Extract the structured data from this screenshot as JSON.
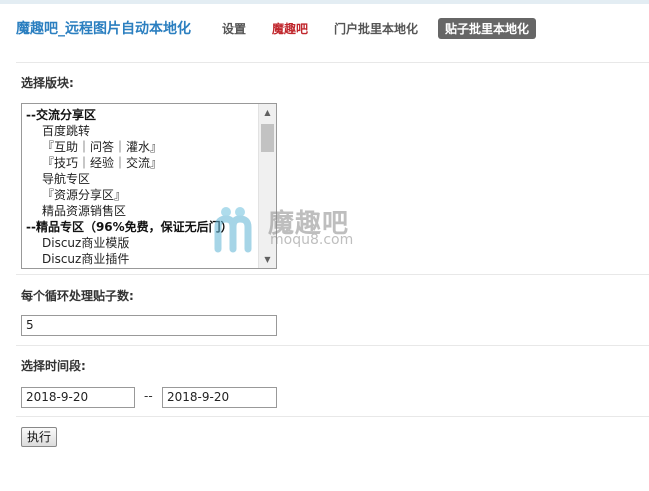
{
  "header": {
    "title": "魔趣吧_远程图片自动本地化",
    "nav": [
      {
        "label": "设置"
      },
      {
        "label": "魔趣吧"
      },
      {
        "label": "门户批里本地化"
      },
      {
        "label": "贴子批里本地化"
      }
    ]
  },
  "form": {
    "forum_select_label": "选择版块:",
    "forum_options": [
      {
        "label": "--交流分享区",
        "group": true
      },
      {
        "label": "百度跳转",
        "group": false
      },
      {
        "label": "『互助｜问答｜灌水』",
        "group": false
      },
      {
        "label": "『技巧｜经验｜交流』",
        "group": false
      },
      {
        "label": "导航专区",
        "group": false
      },
      {
        "label": "『资源分享区』",
        "group": false
      },
      {
        "label": "精品资源销售区",
        "group": false
      },
      {
        "label": "--精品专区（96%免费，保证无后门）",
        "group": true
      },
      {
        "label": "Discuz商业模版",
        "group": false
      },
      {
        "label": "Discuz商业插件",
        "group": false
      }
    ],
    "posts_per_loop_label": "每个循环处理贴子数:",
    "posts_per_loop_value": "5",
    "time_range_label": "选择时间段:",
    "start_date": "2018-9-20",
    "separator": "--",
    "end_date": "2018-9-20",
    "submit_label": "执行"
  },
  "watermark": {
    "text": "魔趣吧",
    "domain": "moqu8.com"
  },
  "colors": {
    "title": "#2b7fc0",
    "brand_link": "#c0272d",
    "active_tab_bg": "#666666"
  }
}
